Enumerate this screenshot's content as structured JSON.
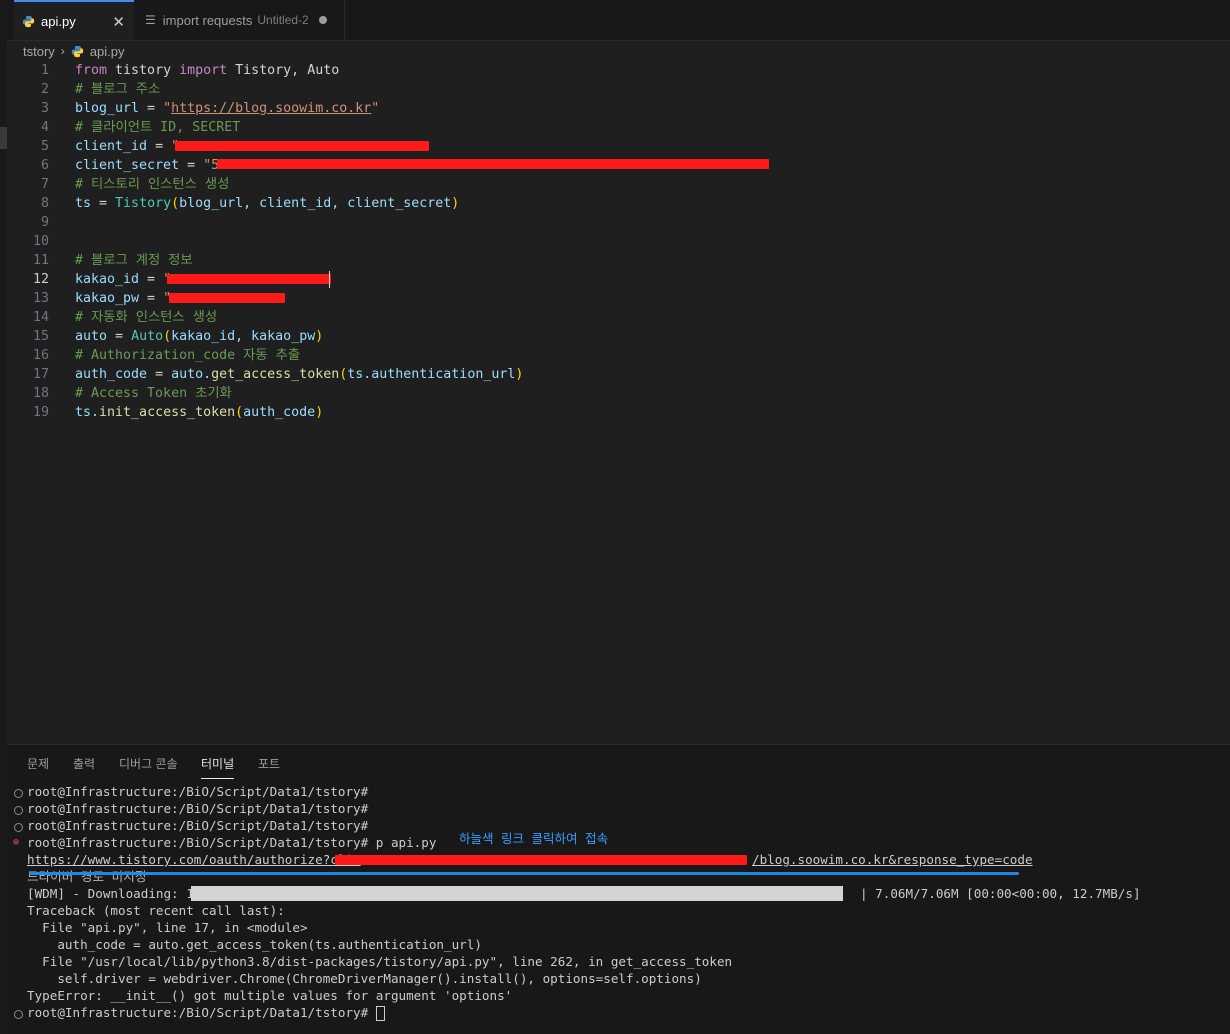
{
  "tabs": [
    {
      "label": "api.py",
      "close": "✕"
    },
    {
      "label": "import requests",
      "sub": "Untitled-2"
    }
  ],
  "breadcrumb": {
    "folder": "tstory",
    "sep": "›",
    "file": "api.py"
  },
  "editor": {
    "line_numbers": [
      "1",
      "2",
      "3",
      "4",
      "5",
      "6",
      "7",
      "8",
      "9",
      "10",
      "11",
      "12",
      "13",
      "14",
      "15",
      "16",
      "17",
      "18",
      "19"
    ],
    "l1": {
      "kw1": "from",
      "mod": " tistory ",
      "kw2": "import",
      "rest": " Tistory, Auto"
    },
    "l2": {
      "comment": "# 블로그 주소"
    },
    "l3": {
      "var": "blog_url",
      "op": " = ",
      "q1": "\"",
      "url": "https://blog.soowim.co.kr",
      "q2": "\""
    },
    "l4": {
      "comment": "# 클라이언트 ID, SECRET"
    },
    "l5": {
      "var": "client_id",
      "op": " = ",
      "str": "\""
    },
    "l6": {
      "var": "client_secret",
      "op": " = ",
      "str": "\"5"
    },
    "l7": {
      "comment": "# 티스토리 인스턴스 생성"
    },
    "l8": {
      "var": "ts",
      "op": " = ",
      "cls": "Tistory",
      "p1": "(",
      "args": "blog_url, client_id, client_secret",
      "p2": ")"
    },
    "l11": {
      "comment": "# 블로그 계정 정보"
    },
    "l12": {
      "var": "kakao_id",
      "op": " = ",
      "str": "\""
    },
    "l13": {
      "var": "kakao_pw",
      "op": " = ",
      "str": "\""
    },
    "l14": {
      "comment": "# 자동화 인스턴스 생성"
    },
    "l15": {
      "var": "auto",
      "op": " = ",
      "cls": "Auto",
      "p1": "(",
      "args": "kakao_id, kakao_pw",
      "p2": ")"
    },
    "l16": {
      "comment": "# Authorization_code 자동 추출"
    },
    "l17": {
      "var": "auth_code",
      "op": " = ",
      "obj": "auto.",
      "fn": "get_access_token",
      "p1": "(",
      "args": "ts.authentication_url",
      "p2": ")"
    },
    "l18": {
      "comment": "# Access Token 초기화"
    },
    "l19": {
      "obj": "ts.",
      "fn": "init_access_token",
      "p1": "(",
      "args": "auth_code",
      "p2": ")"
    }
  },
  "panel": {
    "tabs": [
      "문제",
      "출력",
      "디버그 콘솔",
      "터미널",
      "포트"
    ],
    "active_tab": "터미널",
    "annotation": "하늘색 링크 클릭하여 접속",
    "terminal": {
      "p1": "root@Infrastructure:/BiO/Script/Data1/tstory#",
      "p2": "root@Infrastructure:/BiO/Script/Data1/tstory#",
      "p3": "root@Infrastructure:/BiO/Script/Data1/tstory#",
      "p4": "root@Infrastructure:/BiO/Script/Data1/tstory# p api.py",
      "url_start": "https://www.tistory.com/oauth/authorize?clie",
      "url_end": "/blog.soowim.co.kr&response_type=code",
      "partial": "드라이버 경로 미지정",
      "wdm_left": "[WDM] - Downloading: 100%|",
      "wdm_right": "| 7.06M/7.06M [00:00<00:00, 12.7MB/s]",
      "tb1": "Traceback (most recent call last):",
      "tb2": "  File \"api.py\", line 17, in <module>",
      "tb3": "    auth_code = auto.get_access_token(ts.authentication_url)",
      "tb4": "  File \"/usr/local/lib/python3.8/dist-packages/tistory/api.py\", line 262, in get_access_token",
      "tb5": "    self.driver = webdriver.Chrome(ChromeDriverManager().install(), options=self.options)",
      "tb6": "TypeError: __init__() got multiple values for argument 'options'",
      "p5": "root@Infrastructure:/BiO/Script/Data1/tstory# ",
      "progress": 1.0
    }
  },
  "colors": {
    "accent": "#3b8eea",
    "redaction": "#ff1a1a",
    "annotation": "#1e88e5"
  }
}
